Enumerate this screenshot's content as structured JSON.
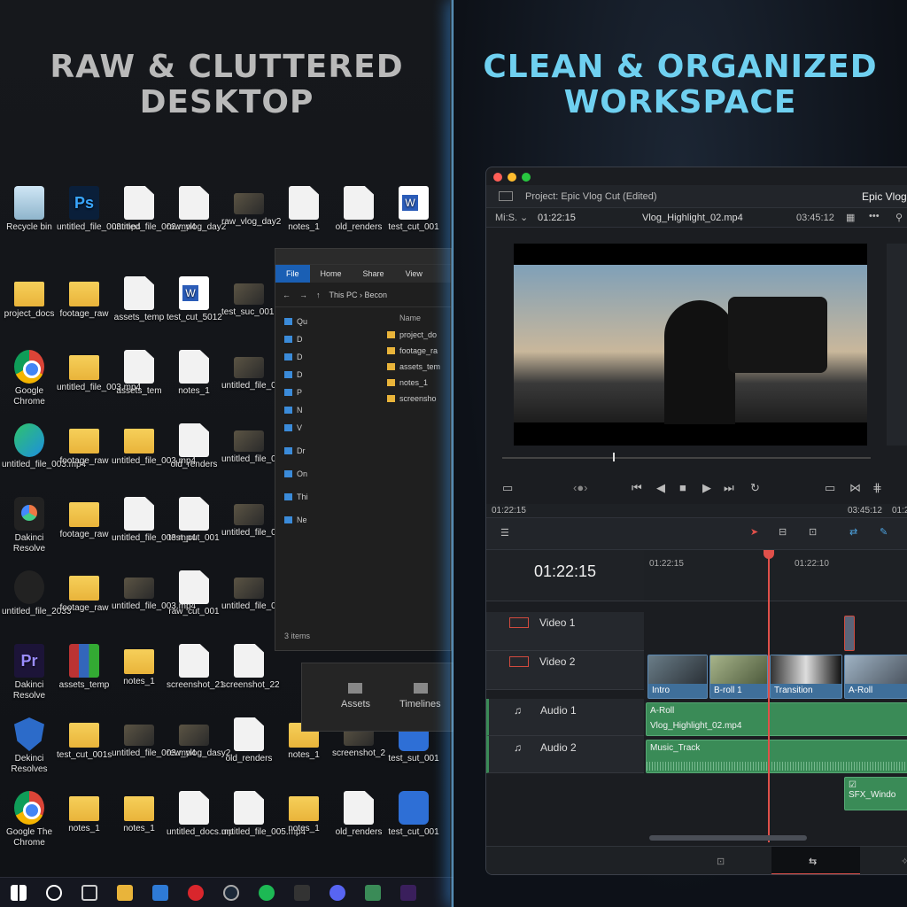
{
  "headline_left": "RAW & CLUTTERED\nDESKTOP",
  "headline_right": "CLEAN & ORGANIZED\nWORKSPACE",
  "desktop_icons": [
    {
      "label": "Recycle bin",
      "icon": "recycle-bin-icon"
    },
    {
      "label": "untitled_file_003.mp4",
      "icon": "photoshop-icon"
    },
    {
      "label": "untitled_file_002.mp4",
      "icon": "file-icon"
    },
    {
      "label": "raw_vlog_day2",
      "icon": "image-file-icon"
    },
    {
      "label": "raw_vlog_day2",
      "icon": "video-thumb-icon"
    },
    {
      "label": "notes_1",
      "icon": "file-icon"
    },
    {
      "label": "old_renders",
      "icon": "file-icon"
    },
    {
      "label": "test_cut_001",
      "icon": "word-icon"
    },
    {
      "label": "project_docs",
      "icon": "folder-icon"
    },
    {
      "label": "footage_raw",
      "icon": "folder-icon"
    },
    {
      "label": "assets_temp",
      "icon": "file-icon"
    },
    {
      "label": "test_cut_5012",
      "icon": "word-icon"
    },
    {
      "label": "test_suc_0012",
      "icon": "video-thumb-icon"
    },
    {
      "label": "Google Chrome",
      "icon": "chrome-icon"
    },
    {
      "label": "untitled_file_003.mp4",
      "icon": "folder-icon"
    },
    {
      "label": "assets_tem",
      "icon": "file-icon"
    },
    {
      "label": "notes_1",
      "icon": "file-icon"
    },
    {
      "label": "untitled_file_003.mp4",
      "icon": "video-thumb-icon"
    },
    {
      "label": "untitled_file_003.mp4",
      "icon": "edge-icon"
    },
    {
      "label": "footage_raw",
      "icon": "folder-icon"
    },
    {
      "label": "untitled_file_003.mp4",
      "icon": "folder-icon"
    },
    {
      "label": "old_renders",
      "icon": "file-icon"
    },
    {
      "label": "untitled_file_003.mp4",
      "icon": "video-thumb-icon"
    },
    {
      "label": "Dakinci Resolve",
      "icon": "davinci-icon"
    },
    {
      "label": "footage_raw",
      "icon": "folder-icon"
    },
    {
      "label": "untitled_file_003.mp4",
      "icon": "file-icon"
    },
    {
      "label": "test_cut_001",
      "icon": "file-icon"
    },
    {
      "label": "untitled_file_003.mp4",
      "icon": "video-thumb-icon"
    },
    {
      "label": "untitled_file_2033",
      "icon": "obs-icon"
    },
    {
      "label": "footage_raw",
      "icon": "zip-folder-icon"
    },
    {
      "label": "untitled_file_003.mp4",
      "icon": "video-thumb-icon"
    },
    {
      "label": "raw_cut_001",
      "icon": "file-icon"
    },
    {
      "label": "untitled_file_003.mp4",
      "icon": "video-thumb-icon"
    },
    {
      "label": "Dakinci Resolve",
      "icon": "premiere-icon"
    },
    {
      "label": "assets_temp",
      "icon": "winrar-icon"
    },
    {
      "label": "notes_1",
      "icon": "folder-icon"
    },
    {
      "label": "screenshot_21",
      "icon": "file-icon"
    },
    {
      "label": "screenshot_22",
      "icon": "file-icon"
    },
    {
      "label": "Dekinci Resolves",
      "icon": "shield-icon"
    },
    {
      "label": "test_cut_001s",
      "icon": "folder-icon"
    },
    {
      "label": "untitled_file_003.mp4",
      "icon": "video-thumb-icon"
    },
    {
      "label": "rew_vlog_dasy2",
      "icon": "video-thumb-icon"
    },
    {
      "label": "old_renders",
      "icon": "file-icon"
    },
    {
      "label": "notes_1",
      "icon": "folder-icon"
    },
    {
      "label": "screenshot_2",
      "icon": "video-thumb-icon"
    },
    {
      "label": "test_sut_001",
      "icon": "blue-app-icon"
    },
    {
      "label": "Google The Chrome",
      "icon": "chrome-icon"
    },
    {
      "label": "notes_1",
      "icon": "folder-icon"
    },
    {
      "label": "notes_1",
      "icon": "zip-folder-icon"
    },
    {
      "label": "untitled_docs.mp",
      "icon": "file-icon"
    },
    {
      "label": "untitled_file_005.mp4",
      "icon": "file-icon"
    },
    {
      "label": "notes_1",
      "icon": "folder-icon"
    },
    {
      "label": "old_renders",
      "icon": "file-icon"
    },
    {
      "label": "test_cut_001",
      "icon": "blue-app-icon"
    }
  ],
  "explorer": {
    "tabs": [
      "File",
      "Home",
      "Share",
      "View"
    ],
    "path": "This PC  ›  Becon",
    "nav": [
      "Qu",
      "D",
      "D",
      "D",
      "P",
      "N",
      "V",
      "Dr",
      "On",
      "Thi",
      "Ne"
    ],
    "column": "Name",
    "files": [
      "project_do",
      "footage_ra",
      "assets_tem",
      "notes_1",
      "screensho"
    ],
    "status": "3 items",
    "popup": [
      "Assets",
      "Timelines"
    ]
  },
  "resolve": {
    "project": "Project: Epic Vlog Cut (Edited)",
    "title_right": "Epic Vlog",
    "viewer_mode": "Mi:S.",
    "timecode": "01:22:15",
    "clip_name": "Vlog_Highlight_02.mp4",
    "duration": "03:45:12",
    "tc_left": "01:22:15",
    "tc_right": "03:45:12",
    "tc_far": "01:2",
    "big_tc": "01:22:15",
    "ruler": [
      "01:22:15",
      "01:22:10"
    ],
    "tracks": [
      "Video 1",
      "Video 2",
      "Audio 1",
      "Audio 2"
    ],
    "clips": [
      "Intro",
      "B-roll 1",
      "Transition",
      "A-Roll"
    ],
    "audio1": [
      "A-Roll",
      "Vlog_Highlight_02.mp4"
    ],
    "audio2": "Music_Track",
    "sfx": "SFX_Windo"
  }
}
